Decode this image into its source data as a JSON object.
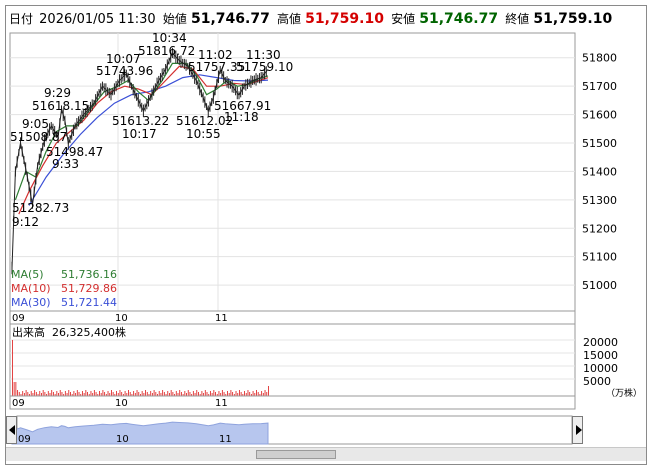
{
  "header": {
    "datetime_label": "日付",
    "datetime": "2026/01/05 11:30",
    "open_label": "始値",
    "open": "51,746.77",
    "high_label": "高値",
    "high": "51,759.10",
    "low_label": "安値",
    "low": "51,746.77",
    "close_label": "終値",
    "close": "51,759.10"
  },
  "colors": {
    "high": "#d40000",
    "low": "#006400",
    "ma5": "#2e7d32",
    "ma10": "#d32f2f",
    "ma30": "#3a4fd6",
    "volume": "#e03030",
    "navigator_fill": "#b7c6ee"
  },
  "legend": {
    "ma5_label": "MA(5)",
    "ma5_value": "51,736.16",
    "ma10_label": "MA(10)",
    "ma10_value": "51,729.86",
    "ma30_label": "MA(30)",
    "ma30_value": "51,721.44"
  },
  "volume": {
    "label": "出来高",
    "value": "26,325,400株",
    "unit": "（万株）",
    "axis_ticks": [
      "20000",
      "15000",
      "10000",
      "5000"
    ]
  },
  "time_labels": [
    "09",
    "10",
    "11"
  ],
  "navigator_labels": [
    "09",
    "10",
    "11"
  ],
  "chart_data": {
    "type": "candlestick",
    "y_ticks": [
      51000,
      51100,
      51200,
      51300,
      51400,
      51500,
      51600,
      51700,
      51800
    ],
    "ylim": [
      50930,
      51880
    ],
    "x_ticks": [
      "09",
      "10",
      "11"
    ],
    "annotations": [
      {
        "time": "9:12",
        "value": "51282.73"
      },
      {
        "time": "9:05",
        "value": "51508.87"
      },
      {
        "time": "9:33",
        "value": "51498.47"
      },
      {
        "time": "9:29",
        "value": "51618.15"
      },
      {
        "time": "10:07",
        "value": "51743.96"
      },
      {
        "time": "10:17",
        "value": "51613.22"
      },
      {
        "time": "10:34",
        "value": "51816.72"
      },
      {
        "time": "10:55",
        "value": "51612.02"
      },
      {
        "time": "11:02",
        "value": "51757.35"
      },
      {
        "time": "11:18",
        "value": "51667.91"
      },
      {
        "time": "11:30",
        "value": "51759.10"
      }
    ],
    "price_path": [
      [
        0,
        51060
      ],
      [
        2,
        51400
      ],
      [
        5,
        51500
      ],
      [
        9,
        51380
      ],
      [
        12,
        51282.73
      ],
      [
        15,
        51420
      ],
      [
        19,
        51508.87
      ],
      [
        23,
        51560
      ],
      [
        27,
        51520
      ],
      [
        29,
        51618.15
      ],
      [
        31,
        51580
      ],
      [
        33,
        51498.47
      ],
      [
        37,
        51560
      ],
      [
        42,
        51600
      ],
      [
        48,
        51640
      ],
      [
        53,
        51700
      ],
      [
        58,
        51670
      ],
      [
        63,
        51720
      ],
      [
        67,
        51743.96
      ],
      [
        70,
        51700
      ],
      [
        74,
        51650
      ],
      [
        77,
        51613.22
      ],
      [
        81,
        51660
      ],
      [
        86,
        51720
      ],
      [
        90,
        51760
      ],
      [
        94,
        51816.72
      ],
      [
        98,
        51790
      ],
      [
        103,
        51770
      ],
      [
        108,
        51720
      ],
      [
        112,
        51660
      ],
      [
        115,
        51612.02
      ],
      [
        118,
        51660
      ],
      [
        122,
        51757.35
      ],
      [
        125,
        51720
      ],
      [
        129,
        51700
      ],
      [
        133,
        51667.91
      ],
      [
        136,
        51700
      ],
      [
        141,
        51720
      ],
      [
        146,
        51730
      ],
      [
        150,
        51759.1
      ]
    ],
    "ma5_path": [
      [
        2,
        51300
      ],
      [
        8,
        51400
      ],
      [
        14,
        51380
      ],
      [
        20,
        51470
      ],
      [
        26,
        51540
      ],
      [
        32,
        51560
      ],
      [
        38,
        51560
      ],
      [
        46,
        51620
      ],
      [
        54,
        51680
      ],
      [
        62,
        51700
      ],
      [
        68,
        51720
      ],
      [
        74,
        51680
      ],
      [
        80,
        51650
      ],
      [
        88,
        51720
      ],
      [
        94,
        51780
      ],
      [
        102,
        51780
      ],
      [
        108,
        51740
      ],
      [
        114,
        51670
      ],
      [
        120,
        51690
      ],
      [
        126,
        51720
      ],
      [
        132,
        51700
      ],
      [
        138,
        51705
      ],
      [
        144,
        51725
      ],
      [
        150,
        51736.16
      ]
    ],
    "ma10_path": [
      [
        4,
        51250
      ],
      [
        10,
        51330
      ],
      [
        18,
        51420
      ],
      [
        26,
        51500
      ],
      [
        34,
        51540
      ],
      [
        42,
        51580
      ],
      [
        50,
        51640
      ],
      [
        58,
        51680
      ],
      [
        66,
        51700
      ],
      [
        74,
        51690
      ],
      [
        82,
        51670
      ],
      [
        90,
        51720
      ],
      [
        98,
        51770
      ],
      [
        106,
        51760
      ],
      [
        114,
        51700
      ],
      [
        122,
        51700
      ],
      [
        130,
        51710
      ],
      [
        138,
        51705
      ],
      [
        144,
        51718
      ],
      [
        150,
        51729.86
      ]
    ],
    "ma30_path": [
      [
        10,
        51280
      ],
      [
        20,
        51380
      ],
      [
        30,
        51460
      ],
      [
        40,
        51530
      ],
      [
        50,
        51590
      ],
      [
        60,
        51640
      ],
      [
        70,
        51670
      ],
      [
        80,
        51680
      ],
      [
        90,
        51700
      ],
      [
        100,
        51730
      ],
      [
        110,
        51740
      ],
      [
        120,
        51730
      ],
      [
        130,
        51720
      ],
      [
        140,
        51718
      ],
      [
        150,
        51721.44
      ]
    ]
  }
}
